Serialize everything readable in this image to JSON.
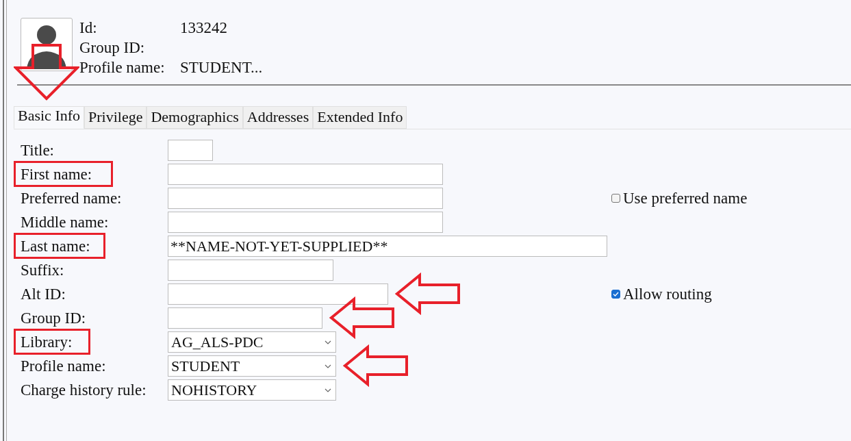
{
  "header": {
    "id_label": "Id:",
    "id_value": "133242",
    "group_label": "Group ID:",
    "profile_label": "Profile name:",
    "profile_value": "STUDENT..."
  },
  "tabs": [
    {
      "label": "Basic Info",
      "selected": true,
      "arrowed": true
    },
    {
      "label": "Privilege",
      "selected": false,
      "arrowed": false
    },
    {
      "label": "Demographics",
      "selected": false,
      "arrowed": false
    },
    {
      "label": "Addresses",
      "selected": false,
      "arrowed": false
    },
    {
      "label": "Extended Info",
      "selected": false,
      "arrowed": false
    }
  ],
  "fields": [
    {
      "label": "Title:",
      "kind": "text",
      "highlighted": false,
      "arrowed": false
    },
    {
      "label": "First name:",
      "kind": "text",
      "highlighted": true,
      "arrowed": false
    },
    {
      "label": "Preferred name:",
      "kind": "text",
      "highlighted": false,
      "arrowed": false,
      "option": {
        "label": "Use preferred name",
        "checked": false
      }
    },
    {
      "label": "Middle name:",
      "kind": "text",
      "highlighted": false,
      "arrowed": false
    },
    {
      "label": "Last name:",
      "kind": "text",
      "value": "**NAME-NOT-YET-SUPPLIED**",
      "highlighted": true,
      "arrowed": false
    },
    {
      "label": "Suffix:",
      "kind": "text",
      "highlighted": false,
      "arrowed": false
    },
    {
      "label": "Alt ID:",
      "kind": "text",
      "highlighted": false,
      "arrowed": true,
      "option": {
        "label": "Allow routing",
        "checked": true
      }
    },
    {
      "label": "Group ID:",
      "kind": "text",
      "highlighted": false,
      "arrowed": true
    },
    {
      "label": "Library:",
      "kind": "select",
      "value": "AG_ALS-PDC",
      "highlighted": true,
      "arrowed": false
    },
    {
      "label": "Profile name:",
      "kind": "select",
      "value": "STUDENT",
      "highlighted": false,
      "arrowed": true
    },
    {
      "label": "Charge history rule:",
      "kind": "select",
      "value": "NOHISTORY",
      "highlighted": false,
      "arrowed": false
    }
  ]
}
